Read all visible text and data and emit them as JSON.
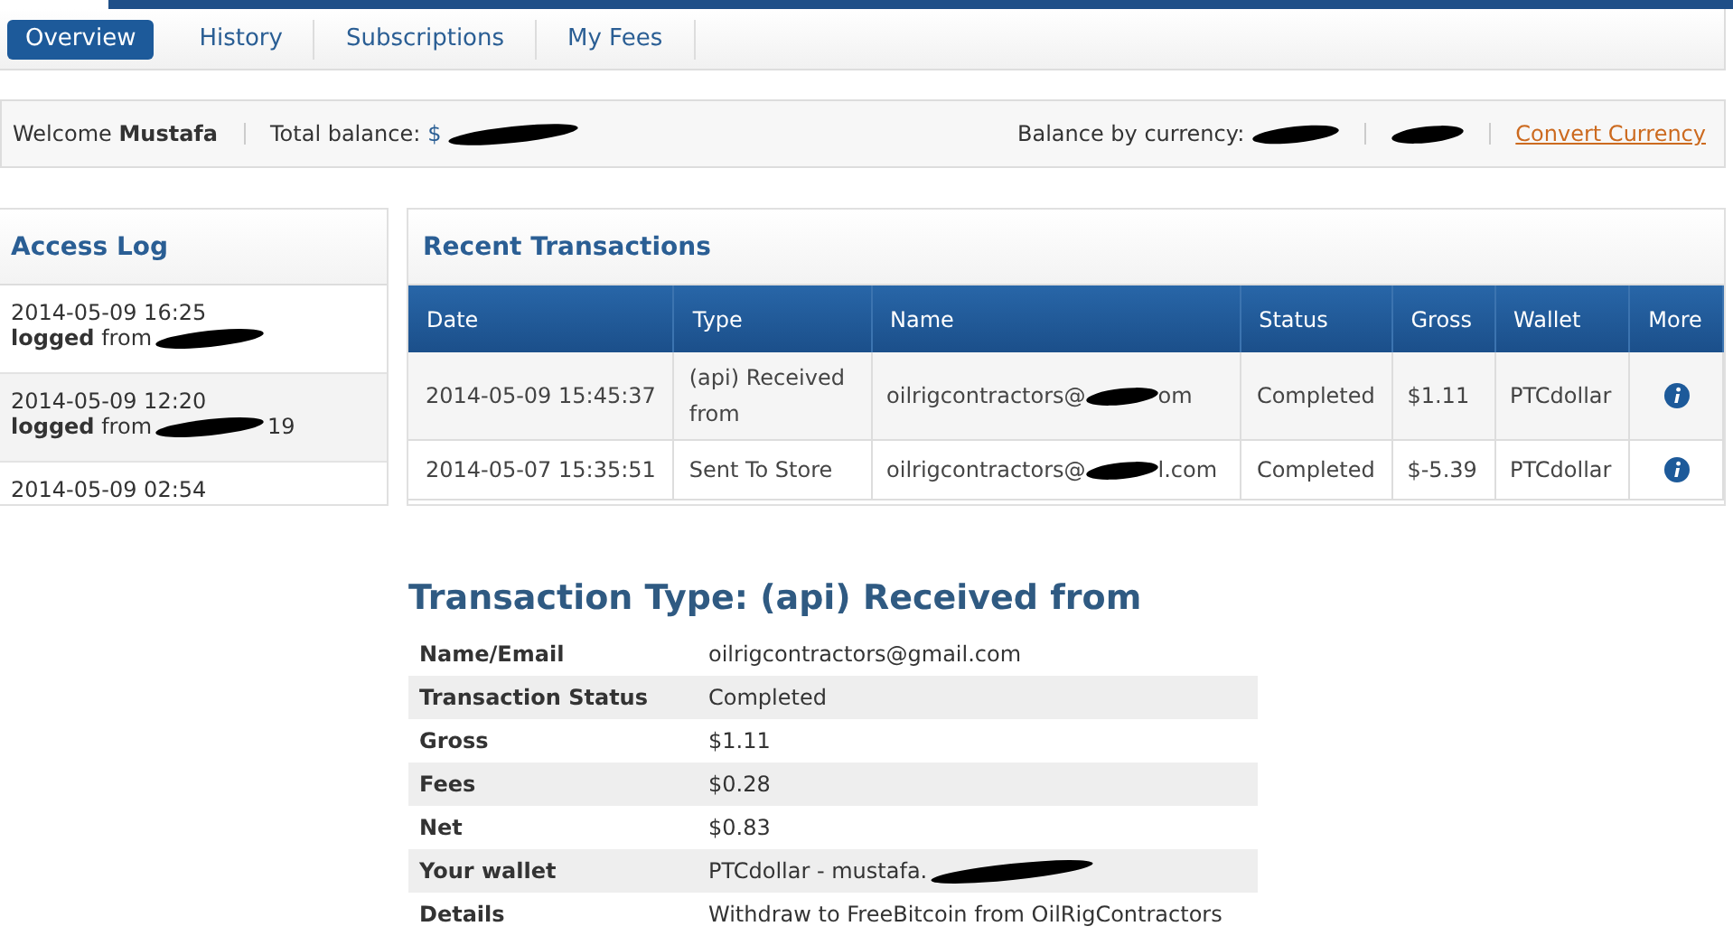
{
  "tabs": [
    {
      "label": "Overview",
      "selected": true
    },
    {
      "label": "History",
      "selected": false
    },
    {
      "label": "Subscriptions",
      "selected": false
    },
    {
      "label": "My Fees",
      "selected": false
    }
  ],
  "balance_bar": {
    "welcome": "Welcome",
    "user": "Mustafa",
    "total_label": "Total balance:",
    "total_value": "$",
    "by_currency_label": "Balance by currency:",
    "convert_link": "Convert Currency"
  },
  "access_log": {
    "title": "Access Log",
    "entries": [
      {
        "time": "2014-05-09 16:25",
        "action": "logged",
        "detail": "from"
      },
      {
        "time": "2014-05-09 12:20",
        "action": "logged",
        "detail": "from",
        "tail": "19"
      },
      {
        "time": "2014-05-09 02:54"
      }
    ]
  },
  "recent_transactions": {
    "title": "Recent Transactions",
    "columns": [
      "Date",
      "Type",
      "Name",
      "Status",
      "Gross",
      "Wallet",
      "More"
    ],
    "rows": [
      {
        "date": "2014-05-09 15:45:37",
        "type": "(api) Received from",
        "name": "oilrigcontractors@",
        "name_tail": "om",
        "status": "Completed",
        "gross": "$1.11",
        "wallet": "PTCdollar"
      },
      {
        "date": "2014-05-07 15:35:51",
        "type": "Sent To Store",
        "name": "oilrigcontractors@",
        "name_tail": "l.com",
        "status": "Completed",
        "gross": "$-5.39",
        "wallet": "PTCdollar"
      }
    ]
  },
  "detail": {
    "title": "Transaction Type: (api) Received from",
    "rows": [
      {
        "label": "Name/Email",
        "value": "oilrigcontractors@gmail.com"
      },
      {
        "label": "Transaction Status",
        "value": "Completed"
      },
      {
        "label": "Gross",
        "value": "$1.11"
      },
      {
        "label": "Fees",
        "value": "$0.28"
      },
      {
        "label": "Net",
        "value": "$0.83"
      },
      {
        "label": "Your wallet",
        "value": "PTCdollar - mustafa.",
        "redacted": true
      },
      {
        "label": "Details",
        "value": "Withdraw to FreeBitcoin from OilRigContractors"
      }
    ]
  }
}
